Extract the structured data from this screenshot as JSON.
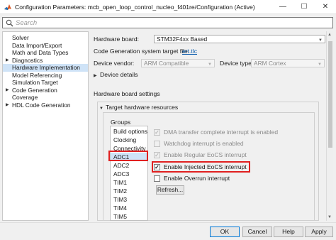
{
  "window": {
    "title": "Configuration Parameters: mcb_open_loop_control_nucleo_f401re/Configuration (Active)",
    "minimize_glyph": "—",
    "maximize_glyph": "☐",
    "close_glyph": "✕",
    "icon": "matlab-icon"
  },
  "search": {
    "placeholder": "Search",
    "value": ""
  },
  "sidebar": {
    "items": [
      {
        "label": "Solver",
        "expandable": false,
        "selected": false
      },
      {
        "label": "Data Import/Export",
        "expandable": false,
        "selected": false
      },
      {
        "label": "Math and Data Types",
        "expandable": false,
        "selected": false
      },
      {
        "label": "Diagnostics",
        "expandable": true,
        "selected": false
      },
      {
        "label": "Hardware Implementation",
        "expandable": false,
        "selected": true
      },
      {
        "label": "Model Referencing",
        "expandable": false,
        "selected": false
      },
      {
        "label": "Simulation Target",
        "expandable": false,
        "selected": false
      },
      {
        "label": "Code Generation",
        "expandable": true,
        "selected": false
      },
      {
        "label": "Coverage",
        "expandable": false,
        "selected": false
      },
      {
        "label": "HDL Code Generation",
        "expandable": true,
        "selected": false
      }
    ]
  },
  "main": {
    "hardware_board_label": "Hardware board:",
    "hardware_board_value": "STM32F4xx Based",
    "target_file_label": "Code Generation system target file:",
    "target_file_link": "ert.tlc",
    "device_vendor_label": "Device vendor:",
    "device_vendor_value": "ARM Compatible",
    "device_type_label": "Device type:",
    "device_type_value": "ARM Cortex",
    "device_details_label": "Device details",
    "board_settings_label": "Hardware board settings",
    "target_resources_label": "Target hardware resources",
    "groups_label": "Groups",
    "groups": [
      {
        "label": "Build options",
        "selected": false
      },
      {
        "label": "Clocking",
        "selected": false
      },
      {
        "label": "Connectivity",
        "selected": false
      },
      {
        "label": "ADC1",
        "selected": true
      },
      {
        "label": "ADC2",
        "selected": false
      },
      {
        "label": "ADC3",
        "selected": false
      },
      {
        "label": "TIM1",
        "selected": false
      },
      {
        "label": "TIM2",
        "selected": false
      },
      {
        "label": "TIM3",
        "selected": false
      },
      {
        "label": "TIM4",
        "selected": false
      },
      {
        "label": "TIM5",
        "selected": false
      }
    ],
    "options": [
      {
        "label": "DMA transfer complete interrupt is enabled",
        "checked": true,
        "enabled": false
      },
      {
        "label": "Watchdog interrupt is enabled",
        "checked": false,
        "enabled": false
      },
      {
        "label": "Enable Regular EoCS interrupt",
        "checked": true,
        "enabled": false
      },
      {
        "label": "Enable Injected EoCS interrupt",
        "checked": true,
        "enabled": true
      },
      {
        "label": "Enable Overrun interrupt",
        "checked": false,
        "enabled": true
      }
    ],
    "refresh_label": "Refresh..."
  },
  "footer": {
    "ok_label": "OK",
    "cancel_label": "Cancel",
    "help_label": "Help",
    "apply_label": "Apply"
  },
  "colors": {
    "selection": "#cfe3f7",
    "highlight_box": "#e02020",
    "link": "#0b5cad"
  }
}
